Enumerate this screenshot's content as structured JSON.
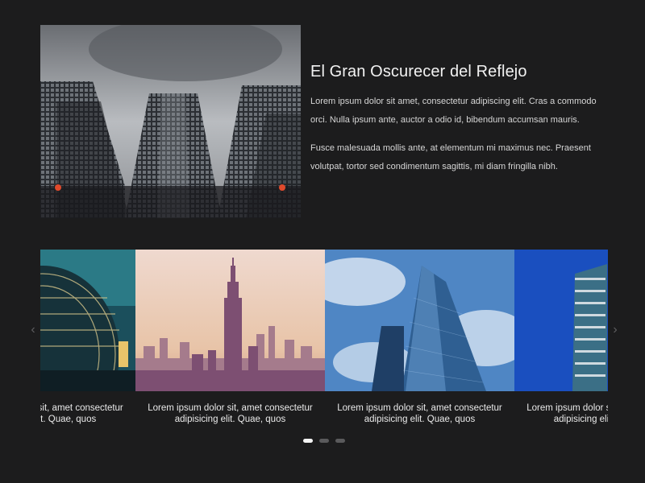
{
  "feature": {
    "title": "El Gran Oscurecer del Reflejo",
    "paragraphs": [
      "Lorem ipsum dolor sit amet, consectetur adipiscing elit. Cras a commodo orci. Nulla ipsum ante, auctor a odio id, bibendum accumsan mauris.",
      "Fusce malesuada mollis ante, at elementum mi maximus nec. Praesent volutpat, tortor sed condimentum sagittis, mi diam fringilla nibh."
    ],
    "image_icon": "skyscrapers-grayscale-photo"
  },
  "carousel": {
    "slides": [
      {
        "caption": "Lorem ipsum dolor sit, amet consectetur adipisicing elit. Quae, quos",
        "image_icon": "glass-dome-night-photo"
      },
      {
        "caption": "Lorem ipsum dolor sit, amet consectetur adipisicing elit. Quae, quos",
        "image_icon": "empire-state-skyline-photo"
      },
      {
        "caption": "Lorem ipsum dolor sit, amet consectetur adipisicing elit. Quae, quos",
        "image_icon": "glass-tower-sky-photo"
      },
      {
        "caption": "Lorem ipsum dolor sit, amet consectetur adipisicing elit. Quae, quos",
        "image_icon": "highrise-blue-sky-photo"
      }
    ],
    "prev_icon": "chevron-left-icon",
    "next_icon": "chevron-right-icon",
    "prev_glyph": "‹",
    "next_glyph": "›",
    "dots_count": 3,
    "active_dot": 1
  }
}
